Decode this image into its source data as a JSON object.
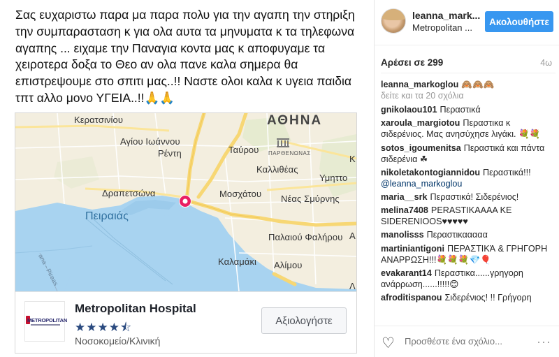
{
  "post": {
    "caption": "Σας ευχαριστω παρα μα παρα πολυ για την αγαπη την στηριξη την συμπαρασταση κ για ολα αυτα τα μηνυματα κ τα τηλεφωνα αγαπης ... ειχαμε την Παναγια κοντα μας κ αποφυγαμε τα χειροτερα δοξα το Θεο αν ολα πανε καλα σημερα θα επιστρεψουμε στο σπιτι μας..!! Ναστε ολοι καλα κ υγεια παιδια τπτ αλλο μονο ΥΓΕΙΑ..!!🙏🙏"
  },
  "map": {
    "labels": {
      "athens": "ΑΘΗΝΑ",
      "keratsini": "Κερατσινίου",
      "agios_ioannis": "Αγίου Ιωάννου",
      "renti": "Ρέντη",
      "tavros": "Ταύρου",
      "parthenon": "ΠΑΡΘΕΝΩΝΑΣ",
      "kallithea": "Καλλιθέας",
      "ymitto": "Υμηττο",
      "drapetsona": "Δραπετσώνα",
      "moschato": "Μοσχάτου",
      "nea_smyrni": "Νέας Σμύρνης",
      "peiraias": "Πειραιάς",
      "palaio_faliro": "Παλαιού Φαλήρου",
      "kalamaki": "Καλαμάκι",
      "alimos": "Αλίμου",
      "road": "ana - Pireas",
      "edge_k": "Κ",
      "edge_a": "Α",
      "edge_lambda": "Λ"
    }
  },
  "place": {
    "name": "Metropolitan Hospital",
    "logo_text": "METROPOLITAN",
    "stars": "★★★★⯪",
    "rating": 4.5,
    "category": "Νοσοκομείο/Κλινική",
    "rate_button": "Αξιολογήστε"
  },
  "header": {
    "username": "leanna_mark...",
    "location": "Metropolitan ...",
    "follow_button": "Ακολουθήστε"
  },
  "meta": {
    "likes": "Αρέσει σε 299",
    "age": "4ω"
  },
  "owner_comment": {
    "user": "leanna_markoglou",
    "text": "🙈🙈🙈"
  },
  "view_more": "δείτε και τα 20 σχόλια",
  "comments": [
    {
      "user": "gnikolaou101",
      "text": "Περαστικά"
    },
    {
      "user": "xaroula_margiotou",
      "text": "Περαστικα κ σιδερένιος. Μας ανησύχησε λιγάκι. 💐💐"
    },
    {
      "user": "sotos_igoumenitsa",
      "text": "Περαστικά και πάντα σιδερένια ☘"
    },
    {
      "user": "nikoletakontogiannidou",
      "text": "Περαστικά!!!",
      "mention": "@leanna_markoglou"
    },
    {
      "user": "maria__srk",
      "text": "Περαστικά! Σιδερένιος!"
    },
    {
      "user": "melina7408",
      "text": "PERASTIKAAAA KE SIDERENIOOS♥♥♥♥♥"
    },
    {
      "user": "manolisss",
      "text": "Περαστικααααα"
    },
    {
      "user": "martiniantigoni",
      "text": "ΠΕΡΑΣΤΙΚΆ & ΓΡΗΓΟΡΗ ΑΝΑΡΡΩΣΗ!!!💐💐💐💎🎈"
    },
    {
      "user": "evakarant14",
      "text": "Περαστικα......γρηγορη ανάρρωση......!!!!!😊"
    },
    {
      "user": "afroditispanou",
      "text": "Σιδερένιος! !! Γρήγορη"
    }
  ],
  "actions": {
    "add_comment_placeholder": "Προσθέστε ένα σχόλιο...",
    "more": "···"
  },
  "colors": {
    "follow_bg": "#3897f0",
    "sea": "#a8d3f0",
    "land": "#f3eedf",
    "road_major": "#f7d774",
    "pin": "#e91e63"
  }
}
